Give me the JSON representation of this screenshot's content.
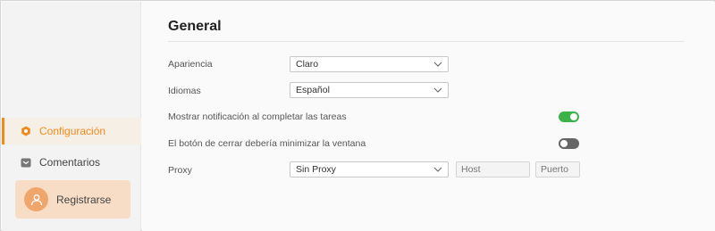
{
  "sidebar": {
    "items": [
      {
        "label": "Configuración",
        "icon": "settings-icon",
        "active": true
      },
      {
        "label": "Comentarios",
        "icon": "mail-icon",
        "active": false
      }
    ],
    "register": {
      "label": "Registrarse",
      "icon": "user-icon"
    }
  },
  "main": {
    "title": "General",
    "appearance": {
      "label": "Apariencia",
      "value": "Claro"
    },
    "language": {
      "label": "Idiomas",
      "value": "Español"
    },
    "notify": {
      "label": "Mostrar notificación al completar las tareas",
      "enabled": true
    },
    "minimize": {
      "label": "El botón de cerrar debería minimizar la ventana",
      "enabled": false
    },
    "proxy": {
      "label": "Proxy",
      "value": "Sin Proxy",
      "host_placeholder": "Host",
      "port_placeholder": "Puerto"
    }
  },
  "colors": {
    "accent": "#f08a1c",
    "toggle_on": "#3cb24a",
    "toggle_off": "#666666"
  }
}
